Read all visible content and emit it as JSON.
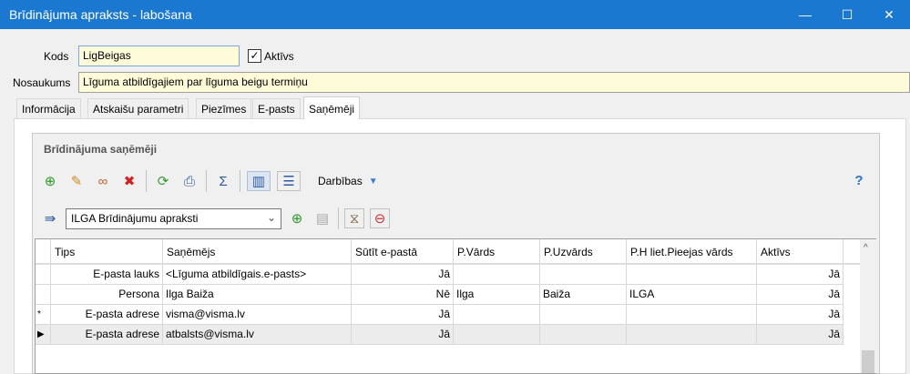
{
  "window": {
    "title": "Brīdinājuma apraksts - labošana",
    "minimize": "—",
    "maximize": "☐",
    "close": "✕"
  },
  "form": {
    "kods_label": "Kods",
    "kods_value": "LigBeigas",
    "aktivs_label": "Aktīvs",
    "aktivs_checked": true,
    "nosaukums_label": "Nosaukums",
    "nosaukums_value": "Līguma atbildīgajiem par līguma beigu termiņu"
  },
  "tabs": [
    {
      "label": "Informācija"
    },
    {
      "label": "Atskaišu parametri"
    },
    {
      "label": "Piezīmes"
    },
    {
      "label": "E-pasts"
    },
    {
      "label": "Saņēmēji",
      "active": true
    }
  ],
  "group": {
    "title": "Brīdinājuma saņēmēji",
    "actions_label": "Darbības",
    "layout_select": "ILGA Brīdinājumu apraksti"
  },
  "grid": {
    "columns": [
      "Tips",
      "Saņēmējs",
      "Sūtīt e-pastā",
      "P.Vārds",
      "P.Uzvārds",
      "P.H liet.Pieejas vārds",
      "Aktīvs"
    ],
    "rows": [
      {
        "indicator": "",
        "cells": [
          "E-pasta lauks",
          "<Līguma atbildīgais.e-pasts>",
          "Jā",
          "",
          "",
          "",
          "Jā"
        ]
      },
      {
        "indicator": "",
        "cells": [
          "Persona",
          "Ilga Baiža",
          "Nē",
          "Ilga",
          "Baiža",
          "ILGA",
          "Jā"
        ]
      },
      {
        "indicator": "*",
        "cells": [
          "E-pasta adrese",
          "visma@visma.lv",
          "Jā",
          "",
          "",
          "",
          "Jā"
        ]
      },
      {
        "indicator": "▶",
        "cells": [
          "E-pasta adrese",
          "atbalsts@visma.lv",
          "Jā",
          "",
          "",
          "",
          "Jā"
        ],
        "selected": true
      }
    ]
  }
}
